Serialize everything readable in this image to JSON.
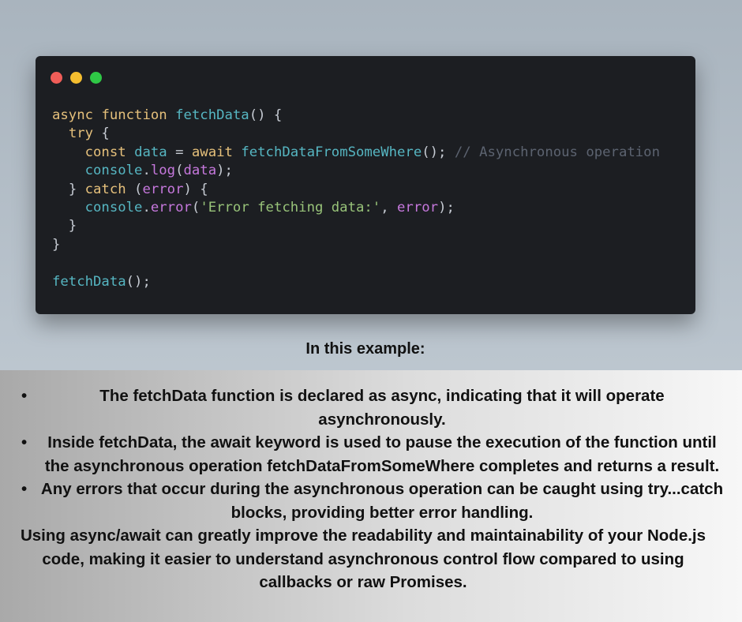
{
  "code_window": {
    "lines": [
      [
        {
          "t": "async",
          "c": "kw"
        },
        {
          "t": " "
        },
        {
          "t": "function",
          "c": "kw"
        },
        {
          "t": " "
        },
        {
          "t": "fetchData",
          "c": "fn"
        },
        {
          "t": "() {",
          "c": "pl"
        }
      ],
      [
        {
          "t": "  "
        },
        {
          "t": "try",
          "c": "kw"
        },
        {
          "t": " {",
          "c": "pl"
        }
      ],
      [
        {
          "t": "    "
        },
        {
          "t": "const",
          "c": "kw"
        },
        {
          "t": " "
        },
        {
          "t": "data",
          "c": "fn"
        },
        {
          "t": " = ",
          "c": "pl"
        },
        {
          "t": "await",
          "c": "kw"
        },
        {
          "t": " "
        },
        {
          "t": "fetchDataFromSomeWhere",
          "c": "fn"
        },
        {
          "t": "(); ",
          "c": "pl"
        },
        {
          "t": "// Asynchronous operation",
          "c": "cm"
        }
      ],
      [
        {
          "t": "    "
        },
        {
          "t": "console",
          "c": "fn"
        },
        {
          "t": ".",
          "c": "pl"
        },
        {
          "t": "log",
          "c": "vr"
        },
        {
          "t": "(",
          "c": "pl"
        },
        {
          "t": "data",
          "c": "vr"
        },
        {
          "t": ");",
          "c": "pl"
        }
      ],
      [
        {
          "t": "  "
        },
        {
          "t": "} ",
          "c": "pl"
        },
        {
          "t": "catch",
          "c": "kw"
        },
        {
          "t": " (",
          "c": "pl"
        },
        {
          "t": "error",
          "c": "vr"
        },
        {
          "t": ") {",
          "c": "pl"
        }
      ],
      [
        {
          "t": "    "
        },
        {
          "t": "console",
          "c": "fn"
        },
        {
          "t": ".",
          "c": "pl"
        },
        {
          "t": "error",
          "c": "vr"
        },
        {
          "t": "(",
          "c": "pl"
        },
        {
          "t": "'Error fetching data:'",
          "c": "str"
        },
        {
          "t": ", ",
          "c": "pl"
        },
        {
          "t": "error",
          "c": "vr"
        },
        {
          "t": ");",
          "c": "pl"
        }
      ],
      [
        {
          "t": "  }",
          "c": "pl"
        }
      ],
      [
        {
          "t": "}",
          "c": "pl"
        }
      ],
      [
        {
          "t": ""
        }
      ],
      [
        {
          "t": "fetchData",
          "c": "fn"
        },
        {
          "t": "();",
          "c": "pl"
        }
      ]
    ]
  },
  "heading": "In this example:",
  "bullets": [
    {
      "marker": "•",
      "text": "The fetchData function is declared as async, indicating that it will operate asynchronously."
    },
    {
      "marker": "•",
      "text": "Inside fetchData, the await keyword is used to pause the execution of the function until the asynchronous operation fetchDataFromSomeWhere completes and returns a result."
    },
    {
      "marker": "•",
      "text": "Any errors that occur during the asynchronous operation can be caught using try...catch blocks, providing better error handling."
    }
  ],
  "summary": "Using async/await can greatly improve the readability and maintainability of your Node.js code, making it easier to understand asynchronous control flow compared to using callbacks or raw Promises.",
  "colors": {
    "keyword": "#e5c07b",
    "function": "#56b6c2",
    "variable": "#c678dd",
    "string": "#98c379",
    "comment": "#5c6370",
    "editor_bg": "#1c1e22"
  }
}
